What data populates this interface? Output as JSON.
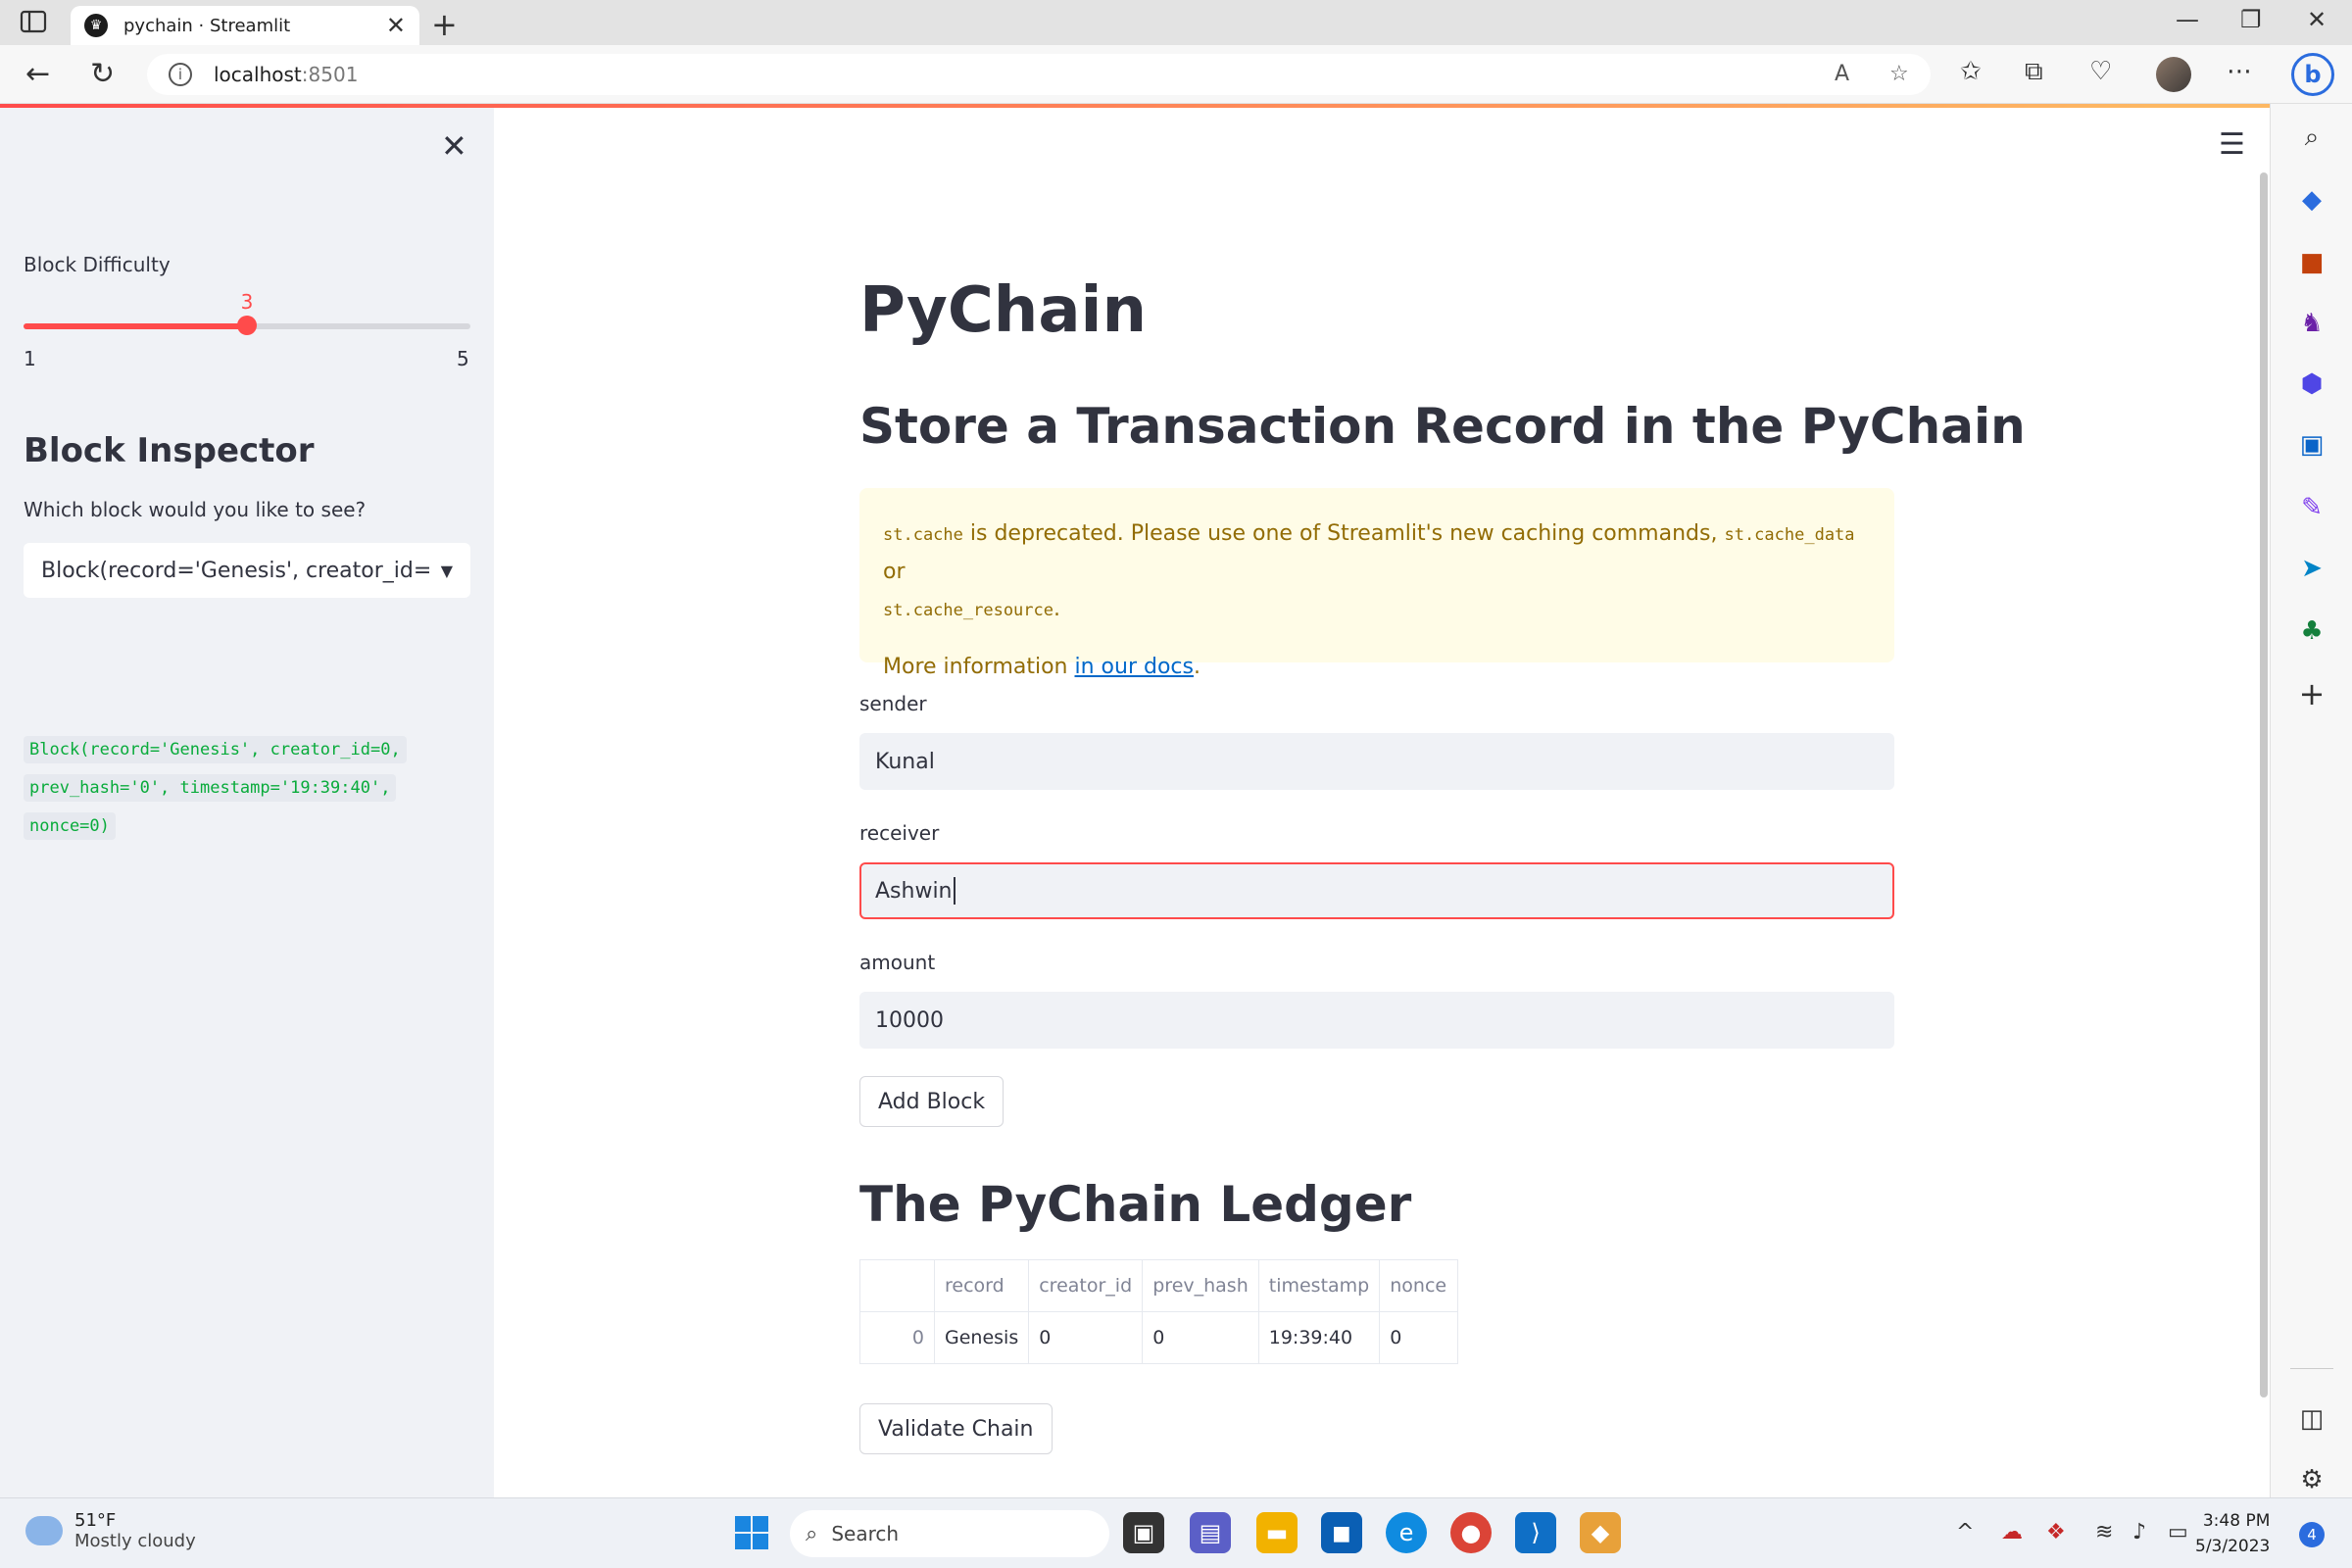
{
  "browser": {
    "tab_title": "pychain · Streamlit",
    "url_host": "localhost",
    "url_port": ":8501"
  },
  "sidebar": {
    "slider": {
      "label": "Block Difficulty",
      "min": 1,
      "max": 5,
      "value": 3,
      "min_label": "1",
      "max_label": "5",
      "value_label": "3"
    },
    "heading": "Block Inspector",
    "question": "Which block would you like to see?",
    "select_value": "Block(record='Genesis', creator_id=...",
    "code_lines": [
      "Block(record='Genesis', creator_id=0,",
      "prev_hash='0', timestamp='19:39:40',",
      "nonce=0)"
    ]
  },
  "main": {
    "title": "PyChain",
    "section_store": "Store a Transaction Record in the PyChain",
    "warning": {
      "code1": "st.cache",
      "text1": " is deprecated. Please use one of Streamlit's new caching commands, ",
      "code2": "st.cache_data",
      "text2": " or ",
      "code3": "st.cache_resource",
      "text3": ".",
      "more_prefix": "More information ",
      "link": "in our docs",
      "more_suffix": "."
    },
    "fields": {
      "sender_label": "sender",
      "sender_value": "Kunal",
      "receiver_label": "receiver",
      "receiver_value": "Ashwin",
      "amount_label": "amount",
      "amount_value": "10000"
    },
    "add_block_label": "Add Block",
    "section_ledger": "The PyChain Ledger",
    "ledger": {
      "columns": [
        "",
        "record",
        "creator_id",
        "prev_hash",
        "timestamp",
        "nonce"
      ],
      "rows": [
        [
          "0",
          "Genesis",
          "0",
          "0",
          "19:39:40",
          "0"
        ]
      ]
    },
    "validate_label": "Validate Chain"
  },
  "taskbar": {
    "temp": "51°F",
    "weather": "Mostly cloudy",
    "search_placeholder": "Search",
    "time": "3:48 PM",
    "date": "5/3/2023",
    "notification_count": "4"
  },
  "colors": {
    "accent": "#ff4b4b",
    "sidebar_bg": "#f0f2f6",
    "warning_bg": "#fffce7",
    "code_green": "#09ab3b"
  }
}
